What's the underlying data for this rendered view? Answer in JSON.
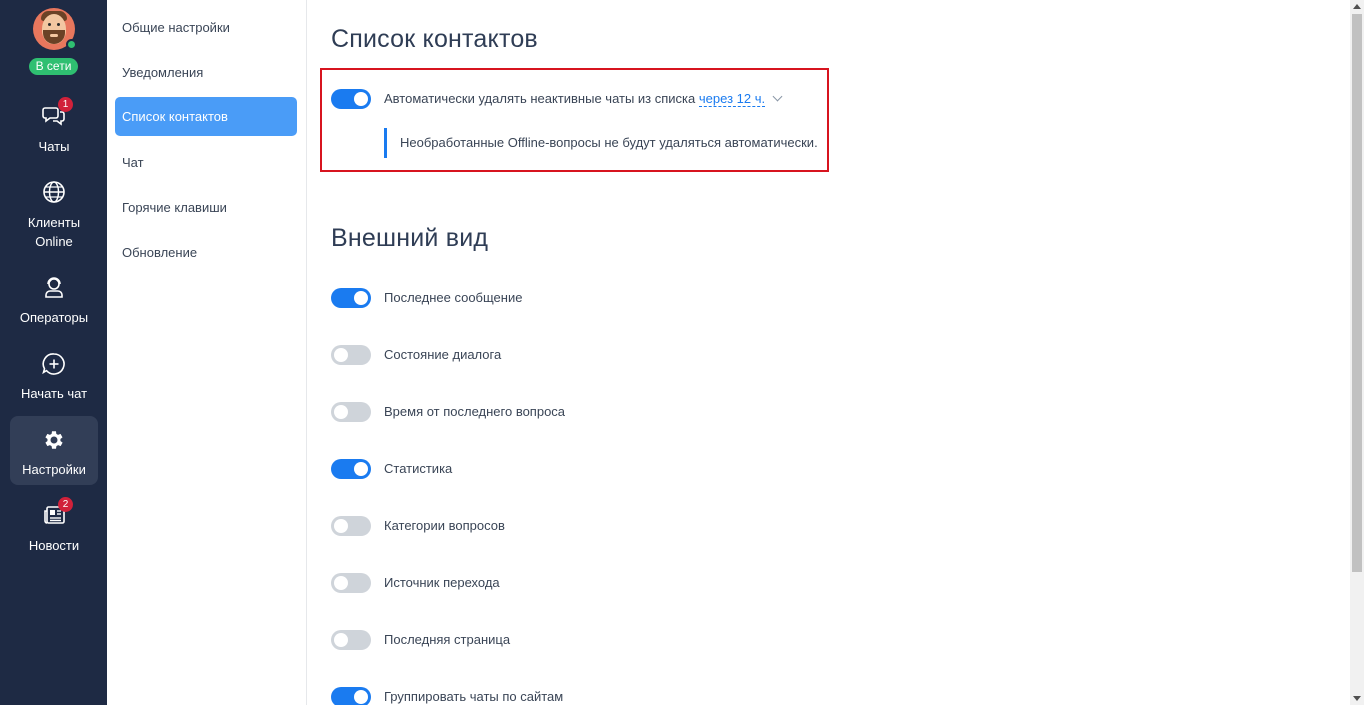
{
  "user": {
    "status": "В сети"
  },
  "nav": {
    "items": [
      {
        "id": "chats",
        "label": "Чаты",
        "icon": "chat-bubbles-icon",
        "badge": "1"
      },
      {
        "id": "clients",
        "label": "Клиенты Online",
        "icon": "globe-icon"
      },
      {
        "id": "operators",
        "label": "Операторы",
        "icon": "operator-headset-icon"
      },
      {
        "id": "start_chat",
        "label": "Начать чат",
        "icon": "chat-plus-icon"
      },
      {
        "id": "settings",
        "label": "Настройки",
        "icon": "gear-icon",
        "active": true
      },
      {
        "id": "news",
        "label": "Новости",
        "icon": "newspaper-icon",
        "badge": "2"
      }
    ]
  },
  "submenu": {
    "items": [
      {
        "label": "Общие настройки"
      },
      {
        "label": "Уведомления"
      },
      {
        "label": "Список контактов",
        "active": true
      },
      {
        "label": "Чат"
      },
      {
        "label": "Горячие клавиши"
      },
      {
        "label": "Обновление"
      }
    ]
  },
  "contacts_section": {
    "title": "Список контактов",
    "auto_delete": {
      "label": "Автоматически удалять неактивные чаты из списка",
      "value": "через 12 ч.",
      "enabled": true
    },
    "note": "Необработанные Offline-вопросы не будут удаляться автоматически."
  },
  "appearance_section": {
    "title": "Внешний вид",
    "toggles": [
      {
        "label": "Последнее сообщение",
        "on": true
      },
      {
        "label": "Состояние диалога",
        "on": false
      },
      {
        "label": "Время от последнего вопроса",
        "on": false
      },
      {
        "label": "Статистика",
        "on": true
      },
      {
        "label": "Категории вопросов",
        "on": false
      },
      {
        "label": "Источник перехода",
        "on": false
      },
      {
        "label": "Последняя страница",
        "on": false
      },
      {
        "label": "Группировать чаты по сайтам",
        "on": true
      }
    ]
  },
  "colors": {
    "nav_bg": "#1e2a44",
    "accent": "#1a7bf0",
    "submenu_active": "#4a9cf7",
    "online": "#2fbf71",
    "badge": "#d1213a",
    "highlight": "#d7141f"
  }
}
